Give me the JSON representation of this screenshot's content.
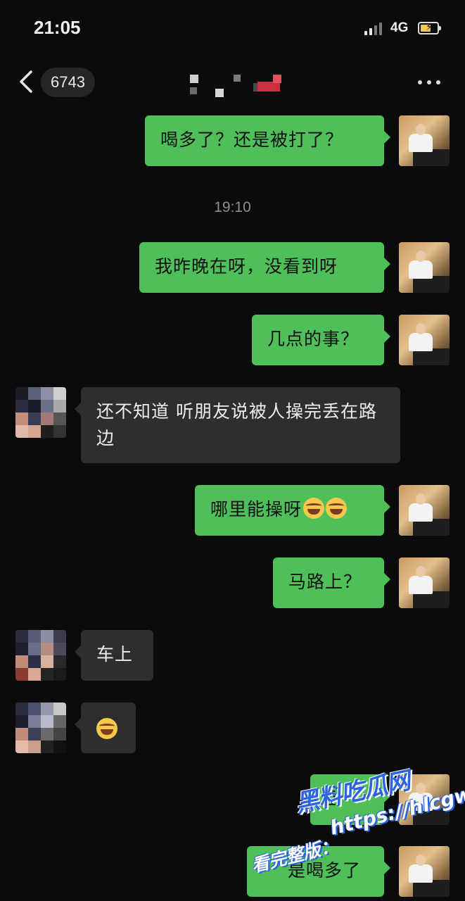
{
  "status_bar": {
    "time": "21:05",
    "network": "4G",
    "battery_state": "charging",
    "accent": "#f2c94c"
  },
  "nav": {
    "back_icon": "chevron-left-icon",
    "unread_count": "6743",
    "more_icon": "more-dots-icon"
  },
  "colors": {
    "background": "#0b0b0b",
    "my_bubble": "#4fbf5a",
    "their_bubble": "#2e2e2e"
  },
  "messages": [
    {
      "from": "me",
      "text": "喝多了？还是被打了？"
    },
    {
      "type": "timestamp",
      "text": "19:10"
    },
    {
      "from": "me",
      "text": "我昨晚在呀，没看到呀"
    },
    {
      "from": "me",
      "text": "几点的事？"
    },
    {
      "from": "them",
      "text": "还不知道 听朋友说被人操完丢在路边"
    },
    {
      "from": "me",
      "text": "哪里能操呀",
      "emoji": "laugh-cry-emoji ×2"
    },
    {
      "from": "me",
      "text": "马路上？"
    },
    {
      "from": "them",
      "text": "车上"
    },
    {
      "from": "them",
      "emoji": "laugh-cry-emoji"
    },
    {
      "from": "me",
      "text": "卧"
    },
    {
      "from": "me",
      "text": "是喝多了"
    }
  ],
  "watermark": {
    "line1": "黑料吃瓜网",
    "line2": "https://hlcgw.co",
    "line3": "看完整版："
  }
}
